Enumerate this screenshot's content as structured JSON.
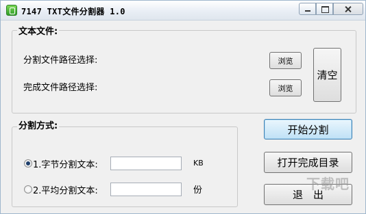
{
  "window": {
    "title": "7147 TXT文件分割器 1.0"
  },
  "file_group": {
    "label": "文本文件:",
    "split_path_label": "分割文件路径选择:",
    "done_path_label": "完成文件路径选择:",
    "browse_label": "浏览",
    "clear_label": "清空"
  },
  "mode_group": {
    "label": "分割方式:",
    "option1_label": "1.字节分割文本:",
    "option1_value": "",
    "option1_unit": "KB",
    "option1_checked": true,
    "option2_label": "2.平均分割文本:",
    "option2_value": "",
    "option2_unit": "份",
    "option2_checked": false
  },
  "actions": {
    "start_label": "开始分割",
    "open_dir_label": "打开完成目录",
    "exit_label": "退　出"
  },
  "watermark": {
    "text": "下载吧"
  }
}
